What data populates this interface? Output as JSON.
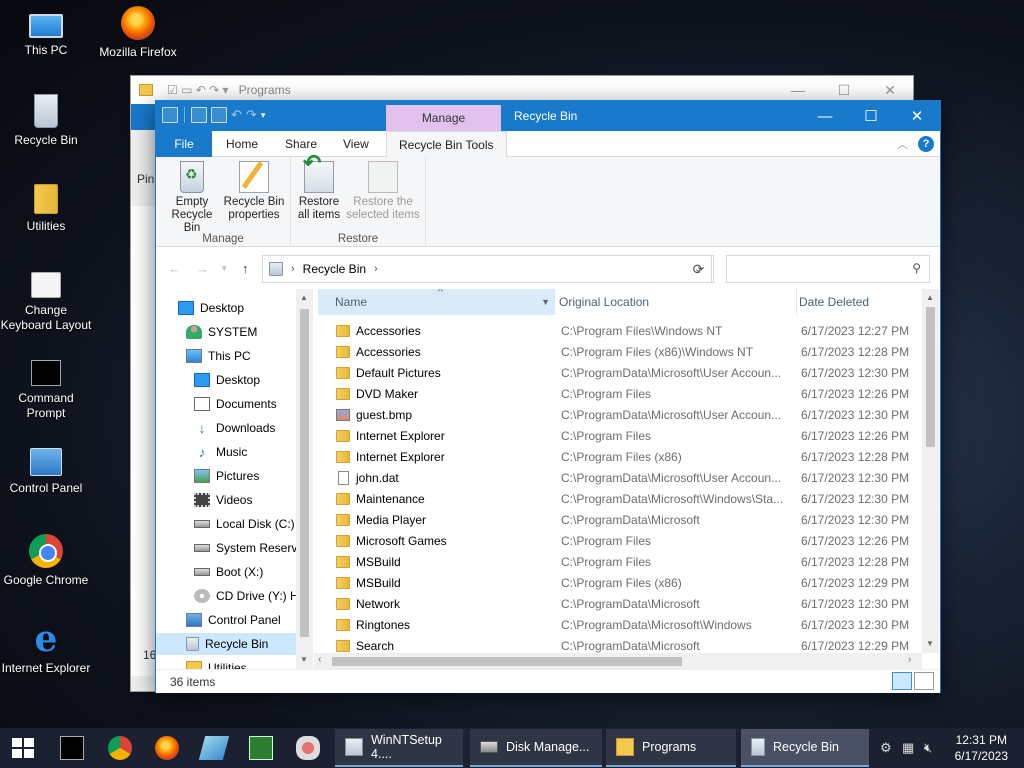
{
  "desktop": {
    "icons": [
      {
        "label": "This PC",
        "icon": "this-pc-icon"
      },
      {
        "label": "Mozilla Firefox",
        "icon": "firefox-icon"
      },
      {
        "label": "Recycle Bin",
        "icon": "recycle-bin-icon"
      },
      {
        "label": "Utilities",
        "icon": "folder-icon"
      },
      {
        "label": "Change Keyboard Layout",
        "icon": "keyboard-icon"
      },
      {
        "label": "Command Prompt",
        "icon": "command-prompt-icon"
      },
      {
        "label": "Control Panel",
        "icon": "control-panel-icon"
      },
      {
        "label": "Google Chrome",
        "icon": "chrome-icon"
      },
      {
        "label": "Internet Explorer",
        "icon": "internet-explorer-icon"
      }
    ]
  },
  "back_window": {
    "title": "Programs",
    "pin_label": "Pin",
    "status_partial": "16"
  },
  "window": {
    "title": "Recycle Bin",
    "context_tab": "Manage",
    "accent": "#1979ca",
    "context_color": "#e3c1ef",
    "tabs": [
      "File",
      "Home",
      "Share",
      "View",
      "Recycle Bin Tools"
    ],
    "ribbon": {
      "groups": [
        {
          "label": "Manage",
          "buttons": [
            {
              "label": "Empty Recycle Bin",
              "icon": "empty-bin-icon"
            },
            {
              "label": "Recycle Bin properties",
              "icon": "properties-icon"
            }
          ]
        },
        {
          "label": "Restore",
          "buttons": [
            {
              "label": "Restore all items",
              "icon": "restore-all-icon"
            },
            {
              "label": "Restore the selected items",
              "icon": "restore-selected-icon",
              "disabled": true
            }
          ]
        }
      ]
    },
    "address": {
      "path": "Recycle Bin",
      "search_placeholder": ""
    },
    "nav": [
      {
        "label": "Desktop",
        "icon": "desktop-icon",
        "indent": 0
      },
      {
        "label": "SYSTEM",
        "icon": "user-icon",
        "indent": 1
      },
      {
        "label": "This PC",
        "icon": "this-pc-icon",
        "indent": 1
      },
      {
        "label": "Desktop",
        "icon": "desktop-icon",
        "indent": 2
      },
      {
        "label": "Documents",
        "icon": "documents-icon",
        "indent": 2
      },
      {
        "label": "Downloads",
        "icon": "downloads-icon",
        "indent": 2
      },
      {
        "label": "Music",
        "icon": "music-icon",
        "indent": 2
      },
      {
        "label": "Pictures",
        "icon": "pictures-icon",
        "indent": 2
      },
      {
        "label": "Videos",
        "icon": "videos-icon",
        "indent": 2
      },
      {
        "label": "Local Disk (C:)",
        "icon": "disk-icon",
        "indent": 2
      },
      {
        "label": "System Reserve",
        "icon": "disk-icon",
        "indent": 2
      },
      {
        "label": "Boot (X:)",
        "icon": "disk-icon",
        "indent": 2
      },
      {
        "label": "CD Drive (Y:) H",
        "icon": "cd-drive-icon",
        "indent": 2
      },
      {
        "label": "Control Panel",
        "icon": "control-panel-icon",
        "indent": 1
      },
      {
        "label": "Recycle Bin",
        "icon": "recycle-bin-icon",
        "indent": 1,
        "selected": true
      },
      {
        "label": "Utilities",
        "icon": "folder-icon",
        "indent": 1
      }
    ],
    "columns": {
      "name": "Name",
      "original_location": "Original Location",
      "date_deleted": "Date Deleted"
    },
    "files": [
      {
        "name": "Accessories",
        "type": "folder",
        "location": "C:\\Program Files\\Windows NT",
        "date": "6/17/2023 12:27 PM"
      },
      {
        "name": "Accessories",
        "type": "folder",
        "location": "C:\\Program Files (x86)\\Windows NT",
        "date": "6/17/2023 12:28 PM"
      },
      {
        "name": "Default Pictures",
        "type": "folder",
        "location": "C:\\ProgramData\\Microsoft\\User Accoun...",
        "date": "6/17/2023 12:30 PM"
      },
      {
        "name": "DVD Maker",
        "type": "folder",
        "location": "C:\\Program Files",
        "date": "6/17/2023 12:26 PM"
      },
      {
        "name": "guest.bmp",
        "type": "bmp",
        "location": "C:\\ProgramData\\Microsoft\\User Accoun...",
        "date": "6/17/2023 12:30 PM"
      },
      {
        "name": "Internet Explorer",
        "type": "folder",
        "location": "C:\\Program Files",
        "date": "6/17/2023 12:26 PM"
      },
      {
        "name": "Internet Explorer",
        "type": "folder",
        "location": "C:\\Program Files (x86)",
        "date": "6/17/2023 12:28 PM"
      },
      {
        "name": "john.dat",
        "type": "file",
        "location": "C:\\ProgramData\\Microsoft\\User Accoun...",
        "date": "6/17/2023 12:30 PM"
      },
      {
        "name": "Maintenance",
        "type": "folder",
        "location": "C:\\ProgramData\\Microsoft\\Windows\\Sta...",
        "date": "6/17/2023 12:30 PM"
      },
      {
        "name": "Media Player",
        "type": "folder",
        "location": "C:\\ProgramData\\Microsoft",
        "date": "6/17/2023 12:30 PM"
      },
      {
        "name": "Microsoft Games",
        "type": "folder",
        "location": "C:\\Program Files",
        "date": "6/17/2023 12:26 PM"
      },
      {
        "name": "MSBuild",
        "type": "folder",
        "location": "C:\\Program Files",
        "date": "6/17/2023 12:28 PM"
      },
      {
        "name": "MSBuild",
        "type": "folder",
        "location": "C:\\Program Files (x86)",
        "date": "6/17/2023 12:29 PM"
      },
      {
        "name": "Network",
        "type": "folder",
        "location": "C:\\ProgramData\\Microsoft",
        "date": "6/17/2023 12:30 PM"
      },
      {
        "name": "Ringtones",
        "type": "folder",
        "location": "C:\\ProgramData\\Microsoft\\Windows",
        "date": "6/17/2023 12:30 PM"
      },
      {
        "name": "Search",
        "type": "folder",
        "location": "C:\\ProgramData\\Microsoft",
        "date": "6/17/2023 12:29 PM"
      }
    ],
    "status": {
      "item_count": "36 items"
    }
  },
  "taskbar": {
    "pinned": [
      "command-prompt-icon",
      "chrome-icon",
      "firefox-icon",
      "pen-tool-icon",
      "spreadsheet-icon",
      "tools-icon"
    ],
    "tasks": [
      {
        "label": "WinNTSetup 4....",
        "icon": "winntsetup-icon"
      },
      {
        "label": "Disk Manage...",
        "icon": "disk-management-icon"
      },
      {
        "label": "Programs",
        "icon": "folder-icon"
      },
      {
        "label": "Recycle Bin",
        "icon": "recycle-bin-icon",
        "active": true
      }
    ],
    "time": "12:31 PM",
    "date": "6/17/2023"
  }
}
